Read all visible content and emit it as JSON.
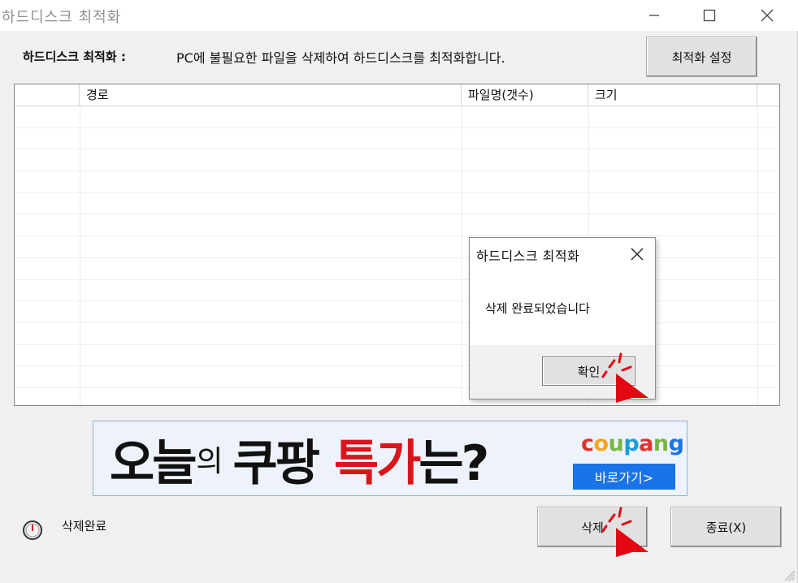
{
  "window": {
    "title": "하드디스크 최적화"
  },
  "header": {
    "label": "하드디스크 최적화 :",
    "description": "PC에 불필요한 파일을 삭제하여 하드디스크를 최적화합니다.",
    "settings_button": "최적화 설정"
  },
  "table": {
    "columns": [
      "",
      "경로",
      "파일명(갯수)",
      "크기",
      ""
    ],
    "rows": []
  },
  "dialog": {
    "title": "하드디스크 최적화",
    "message": "삭제 완료되었습니다",
    "ok_button": "확인"
  },
  "ad": {
    "headline_1": "오늘",
    "headline_2": "의",
    "headline_3": "쿠팡",
    "headline_4": "특가",
    "headline_5": "는?",
    "brand": "coupang",
    "cta": "바로가기>",
    "brand_colors": [
      "#e0312b",
      "#f5a623",
      "#7bb542",
      "#1a9fd8",
      "#e0312b",
      "#7bb542",
      "#1a73e8"
    ]
  },
  "status": {
    "text": "삭제완료"
  },
  "footer": {
    "delete_button": "삭제",
    "exit_button": "종료(X)"
  },
  "colors": {
    "accent_red": "#d9161b",
    "cta_blue": "#1a73e8",
    "cursor_red": "#e30613"
  }
}
